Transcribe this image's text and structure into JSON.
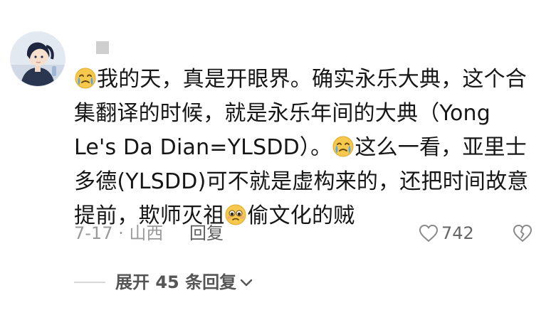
{
  "comment": {
    "text_segments": [
      {
        "type": "emoji",
        "icon": "crying-emoji"
      },
      {
        "type": "text",
        "value": "我的天，真是开眼界。确实永乐大典，这个合集翻译的时候，就是永乐年间的大典（Yong Le's Da Dian=YLSDD）。"
      },
      {
        "type": "emoji",
        "icon": "crying-emoji"
      },
      {
        "type": "text",
        "value": "这么一看，亚里士多德(YLSDD)可不就是虚构来的，还把时间故意提前，欺师灭祖"
      },
      {
        "type": "emoji",
        "icon": "pleading-face-emoji"
      },
      {
        "type": "text",
        "value": "偷文化的贼"
      }
    ],
    "date_location": "7-17 · 山西",
    "reply_label": "回复",
    "like_count": "742",
    "expand_replies_label": "展开 45 条回复"
  },
  "colors": {
    "meta_gray": "#9a9a9a",
    "icon_gray": "#8a8a8a",
    "text_dark": "#161616",
    "emoji_yellow": "#f6c84c",
    "tear_blue": "#58a8e8"
  }
}
